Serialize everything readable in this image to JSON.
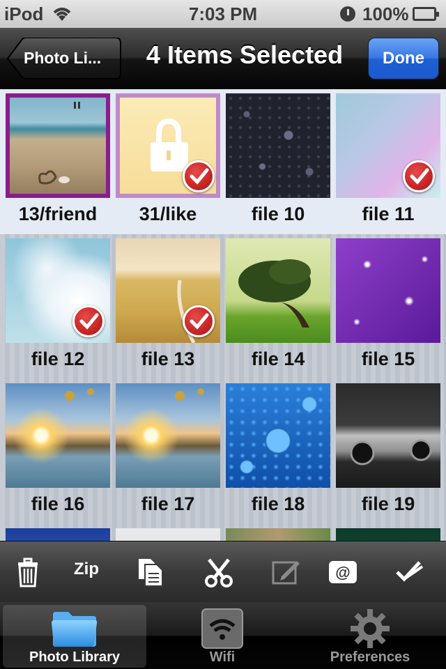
{
  "status_bar": {
    "carrier": "iPod",
    "time": "7:03 PM",
    "battery": "100%"
  },
  "nav": {
    "back_label": "Photo Li...",
    "title": "4 Items Selected",
    "done_label": "Done"
  },
  "grid": {
    "items": [
      {
        "label": "13/friend",
        "selected": true
      },
      {
        "label": "31/like",
        "selected": true
      },
      {
        "label": "file 10",
        "selected": false
      },
      {
        "label": "file 11",
        "selected": true
      },
      {
        "label": "file 12",
        "selected": true
      },
      {
        "label": "file 13",
        "selected": true
      },
      {
        "label": "file 14",
        "selected": false
      },
      {
        "label": "file 15",
        "selected": false
      },
      {
        "label": "file 16",
        "selected": false
      },
      {
        "label": "file 17",
        "selected": false
      },
      {
        "label": "file 18",
        "selected": false
      },
      {
        "label": "file 19",
        "selected": false
      }
    ]
  },
  "toolbar": {
    "zip_label": "Zip",
    "icons": [
      "trash-icon",
      "zip-icon",
      "copy-icon",
      "scissors-icon",
      "edit-icon",
      "email-icon",
      "select-all-icon"
    ]
  },
  "tabs": [
    {
      "label": "Photo Library",
      "icon": "folder-icon",
      "active": true
    },
    {
      "label": "Wifi",
      "icon": "wifi-icon",
      "active": false
    },
    {
      "label": "Preferences",
      "icon": "gear-icon",
      "active": false
    }
  ],
  "colors": {
    "selection_outline": "#8a1c8c",
    "check_badge": "#c41a1a",
    "done_button": "#2f6fe0"
  }
}
